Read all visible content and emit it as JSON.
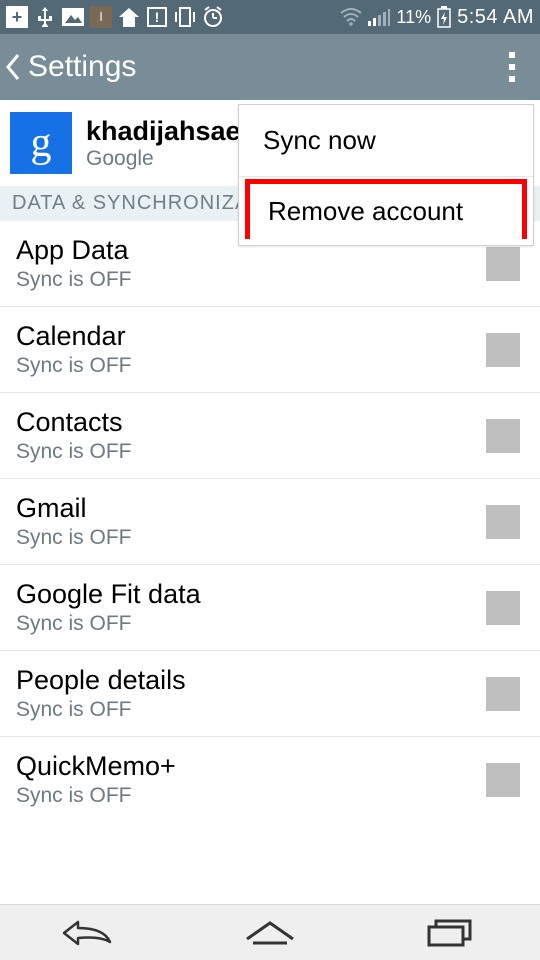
{
  "status": {
    "battery_pct": "11%",
    "time": "5:54 AM"
  },
  "appbar": {
    "title": "Settings"
  },
  "account": {
    "name": "khadijahsae",
    "provider": "Google",
    "badge_letter": "g"
  },
  "section_header": "DATA & SYNCHRONIZA",
  "sync_off_text": "Sync is OFF",
  "items": [
    {
      "label": "App Data"
    },
    {
      "label": "Calendar"
    },
    {
      "label": "Contacts"
    },
    {
      "label": "Gmail"
    },
    {
      "label": "Google Fit data"
    },
    {
      "label": "People details"
    },
    {
      "label": "QuickMemo+"
    }
  ],
  "popup": {
    "sync_now": "Sync now",
    "remove_account": "Remove account"
  }
}
